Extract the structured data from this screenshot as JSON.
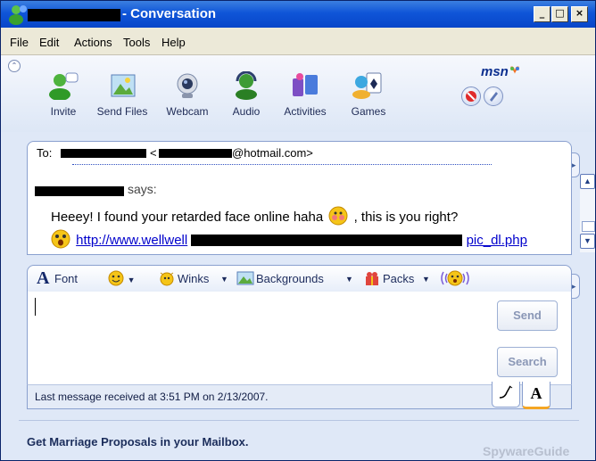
{
  "window": {
    "title": "- Conversation"
  },
  "menu": [
    "File",
    "Edit",
    "Actions",
    "Tools",
    "Help"
  ],
  "toolbar": {
    "buttons": [
      {
        "label": "Invite",
        "icon": "invite-icon"
      },
      {
        "label": "Send Files",
        "icon": "send-files-icon"
      },
      {
        "label": "Webcam",
        "icon": "webcam-icon"
      },
      {
        "label": "Audio",
        "icon": "audio-icon"
      },
      {
        "label": "Activities",
        "icon": "activities-icon"
      },
      {
        "label": "Games",
        "icon": "games-icon"
      }
    ],
    "logo": "msn"
  },
  "to": {
    "label": "To:",
    "email_suffix": "@hotmail.com>",
    "lt": "<"
  },
  "history": {
    "says": "says:",
    "message": "Heeey! I found your retarded face online haha",
    "message_tail": ", this is you right?",
    "link_start": "http://www.wellwell",
    "link_end": "pic_dl.php"
  },
  "format_bar": {
    "font": "Font",
    "winks": "Winks",
    "backgrounds": "Backgrounds",
    "packs": "Packs"
  },
  "compose": {
    "send": "Send",
    "search": "Search"
  },
  "status": {
    "text": "Last message received at 3:51 PM on 2/13/2007."
  },
  "banner": {
    "text": "Get Marriage Proposals in your Mailbox."
  },
  "watermark": "SpywareGuide"
}
